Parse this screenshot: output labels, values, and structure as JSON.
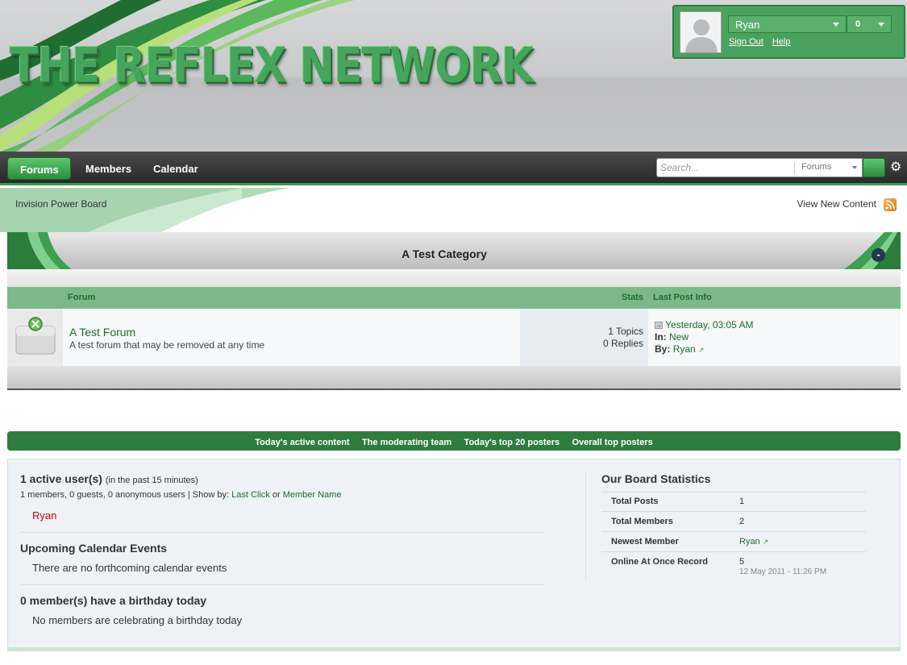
{
  "header": {
    "logo_text": "THE REFLEX NETWORK",
    "user": {
      "name": "Ryan",
      "notifications": "0",
      "sign_out": "Sign Out",
      "help": "Help"
    }
  },
  "nav": {
    "tabs": [
      {
        "label": "Forums",
        "active": true
      },
      {
        "label": "Members",
        "active": false
      },
      {
        "label": "Calendar",
        "active": false
      }
    ],
    "search_placeholder": "Search...",
    "search_scope": "Forums"
  },
  "subbar": {
    "breadcrumb": "Invision Power Board",
    "view_new": "View New Content"
  },
  "category": {
    "title": "A Test Category",
    "toggle": "-",
    "columns": {
      "forum": "Forum",
      "stats": "Stats",
      "last_post": "Last Post Info"
    },
    "forums": [
      {
        "name": "A Test Forum",
        "description": "A test forum that may be removed at any time",
        "topics": "1 Topics",
        "replies": "0 Replies",
        "last_post_date": "Yesterday, 03:05 AM",
        "in_label": "In:",
        "in_topic": "New",
        "by_label": "By:",
        "by_user": "Ryan"
      }
    ]
  },
  "stats_links": [
    "Today's active content",
    "The moderating team",
    "Today's top 20 posters",
    "Overall top posters"
  ],
  "board": {
    "active_title": "1 active user(s)",
    "active_note": "(in the past 15 minutes)",
    "active_breakdown": "1 members, 0 guests, 0 anonymous users | Show by:",
    "show_last_click": "Last Click",
    "or": "or",
    "show_member_name": "Member Name",
    "active_user": "Ryan",
    "events_title": "Upcoming Calendar Events",
    "events_text": "There are no forthcoming calendar events",
    "birthday_title": "0 member(s) have a birthday today",
    "birthday_text": "No members are celebrating a birthday today",
    "stats_title": "Our Board Statistics",
    "stats": {
      "total_posts_label": "Total Posts",
      "total_posts": "1",
      "total_members_label": "Total Members",
      "total_members": "2",
      "newest_member_label": "Newest Member",
      "newest_member": "Ryan",
      "online_record_label": "Online At Once Record",
      "online_record": "5",
      "online_record_date": "12 May 2011 - 11:26 PM"
    }
  },
  "colors": {
    "accent": "#3a9a4d",
    "link": "#1e6b2c",
    "online_user": "#cc0000"
  }
}
